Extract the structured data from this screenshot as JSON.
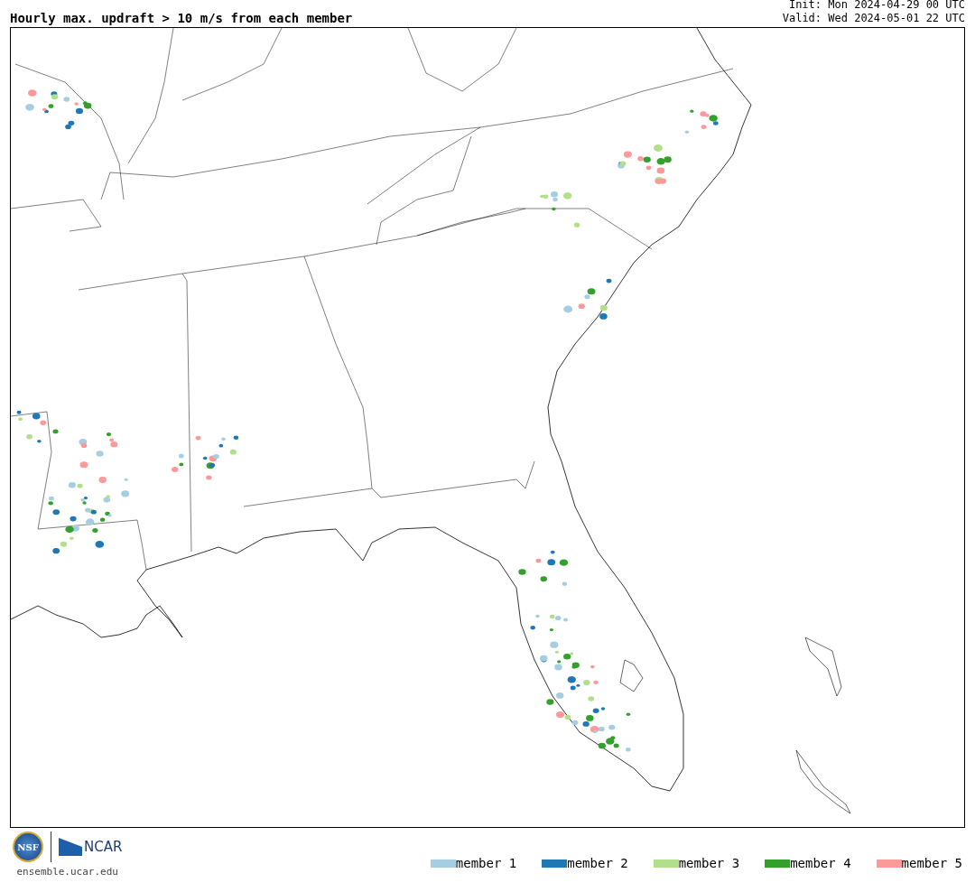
{
  "title": "Hourly max. updraft > 10 m/s from each member",
  "init": "Init: Mon 2024-04-29 00 UTC",
  "valid": "Valid: Wed 2024-05-01 22 UTC",
  "logos": {
    "nsf": "NSF",
    "ncar": "NCAR",
    "url": "ensemble.ucar.edu"
  },
  "legend": [
    {
      "label": "member 1",
      "color": "#a6cee3"
    },
    {
      "label": "member 2",
      "color": "#1f78b4"
    },
    {
      "label": "member 3",
      "color": "#b2df8a"
    },
    {
      "label": "member 4",
      "color": "#33a02c"
    },
    {
      "label": "member 5",
      "color": "#fb9a99"
    }
  ]
}
